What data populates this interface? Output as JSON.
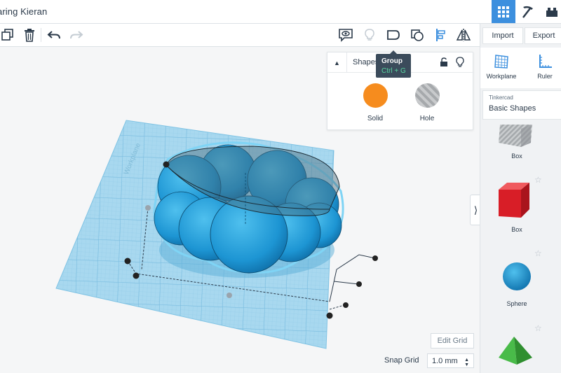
{
  "document": {
    "title": "aring Kieran"
  },
  "header": {
    "view_buttons": [
      {
        "name": "3d-design",
        "active": true
      },
      {
        "name": "build",
        "active": false
      },
      {
        "name": "bricks",
        "active": false
      }
    ]
  },
  "toolbar": {
    "icons": [
      "copy-icon",
      "trash-icon",
      "undo-icon",
      "redo-icon",
      "notes-icon",
      "light-bulb-icon",
      "group-icon",
      "ungroup-icon",
      "align-icon",
      "mirror-icon"
    ]
  },
  "tooltip": {
    "title": "Group",
    "shortcut": "Ctrl + G"
  },
  "inspector": {
    "title": "Shapes",
    "options": [
      {
        "label": "Solid",
        "color": "#f68c1e"
      },
      {
        "label": "Hole",
        "color": "#b5b7b9"
      }
    ]
  },
  "rightpanel": {
    "import_label": "Import",
    "export_label": "Export",
    "tools": [
      {
        "label": "Workplane"
      },
      {
        "label": "Ruler"
      }
    ],
    "library": {
      "provider": "Tinkercad",
      "name": "Basic Shapes"
    },
    "shapes": [
      {
        "label": "Box",
        "kind": "box-hole"
      },
      {
        "label": "Box",
        "kind": "box"
      },
      {
        "label": "Sphere",
        "kind": "sphere"
      },
      {
        "label": "",
        "kind": "roof"
      }
    ]
  },
  "viewport": {
    "collapse_glyph": "⟩",
    "edit_grid_label": "Edit Grid",
    "snap_grid_label": "Snap Grid",
    "snap_grid_value": "1.0 mm",
    "workplane_label": "Workplane"
  },
  "colors": {
    "accent": "#3c8fde",
    "shape_blue": "#1f9ad6",
    "workplane": "#a8d8ef",
    "solid_orange": "#f68c1e",
    "box_red": "#d81e27",
    "roof_green": "#3caa3c"
  }
}
